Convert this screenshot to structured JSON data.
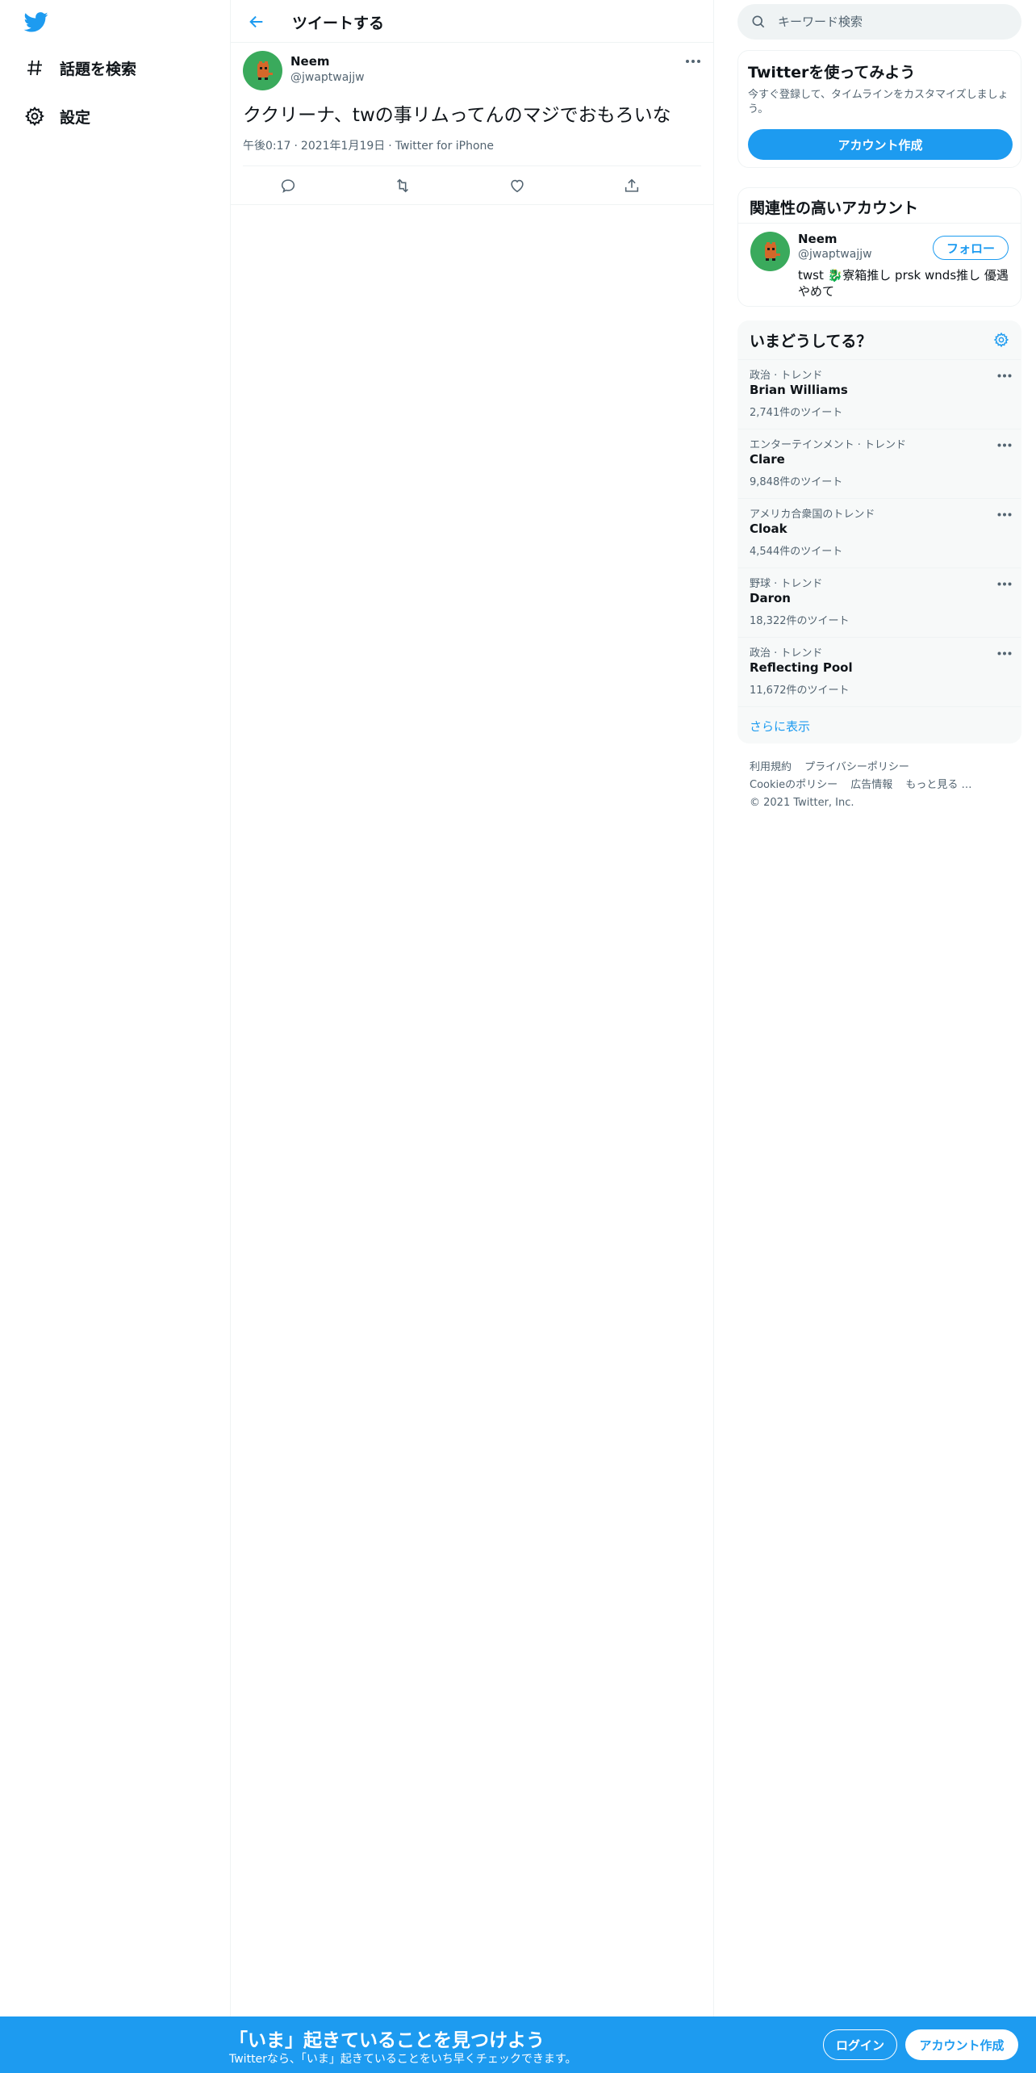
{
  "nav": {
    "logo_icon": "twitter-bird-icon",
    "items": [
      {
        "label": "話題を検索",
        "icon": "hashtag-icon"
      },
      {
        "label": "設定",
        "icon": "gear-icon"
      }
    ]
  },
  "header": {
    "title": "ツイートする",
    "back_icon": "arrow-left-icon"
  },
  "tweet": {
    "name": "Neem",
    "handle": "@jwaptwajjw",
    "text": "ククリーナ、twの事リムってんのマジでおもろいな",
    "time": "午後0:17",
    "date": "2021年1月19日",
    "source": "Twitter for iPhone",
    "separator": "·"
  },
  "search": {
    "placeholder": "キーワード検索"
  },
  "signup_card": {
    "title": "Twitterを使ってみよう",
    "subtitle": "今すぐ登録して、タイムラインをカスタマイズしましょう。",
    "button": "アカウント作成"
  },
  "related": {
    "title": "関連性の高いアカウント",
    "name": "Neem",
    "handle": "@jwaptwajjw",
    "bio": "twst 🐉寮箱推し prsk wnds推し 優遇やめて",
    "follow": "フォロー"
  },
  "trends": {
    "title": "いまどうしてる？",
    "items": [
      {
        "category": "政治 · トレンド",
        "name": "Brian Williams",
        "count": "2,741件のツイート"
      },
      {
        "category": "エンターテインメント · トレンド",
        "name": "Clare",
        "count": "9,848件のツイート"
      },
      {
        "category": "アメリカ合衆国のトレンド",
        "name": "Cloak",
        "count": "4,544件のツイート"
      },
      {
        "category": "野球 · トレンド",
        "name": "Daron",
        "count": "18,322件のツイート"
      },
      {
        "category": "政治 · トレンド",
        "name": "Reflecting Pool",
        "count": "11,672件のツイート"
      }
    ],
    "show_more": "さらに表示"
  },
  "footer": {
    "links": [
      "利用規約",
      "プライバシーポリシー",
      "Cookieのポリシー",
      "広告情報",
      "もっと見る …"
    ],
    "copyright": "© 2021 Twitter, Inc."
  },
  "bottom_bar": {
    "title": "「いま」起きていることを見つけよう",
    "subtitle": "Twitterなら、「いま」起きていることをいち早くチェックできます。",
    "login": "ログイン",
    "signup": "アカウント作成"
  },
  "colors": {
    "accent": "#1d9bf0",
    "text": "#0f1419",
    "muted": "#536471",
    "avatar_bg": "#3aaa5c"
  }
}
